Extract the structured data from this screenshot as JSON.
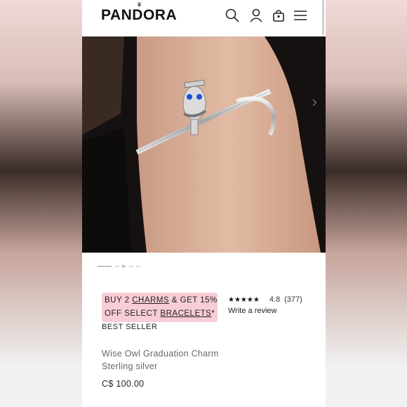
{
  "brand": {
    "logo_text": "PANDORA"
  },
  "header": {
    "icons": [
      "search-icon",
      "account-icon",
      "bag-icon",
      "menu-icon"
    ]
  },
  "gallery": {
    "next_arrow": "›",
    "slide_count": 5,
    "active_slide": 1
  },
  "promo": {
    "part1": "BUY 2 ",
    "charms_link": "CHARMS",
    "part2": " & GET 15%",
    "part3": "OFF SELECT ",
    "bracelets_link": "BRACELETS",
    "asterisk": "*"
  },
  "rating": {
    "stars": "★★★★★",
    "value": "4.8",
    "count": "(377)",
    "review_link": "Write a review"
  },
  "product": {
    "badge": "BEST SELLER",
    "name": "Wise Owl Graduation Charm",
    "material": "Sterling silver",
    "price": "C$ 100.00"
  },
  "colors": {
    "promo_bg": "#f8cdd6",
    "text": "#222222",
    "muted": "#666666",
    "charm_gem": "#1f4fd0"
  }
}
